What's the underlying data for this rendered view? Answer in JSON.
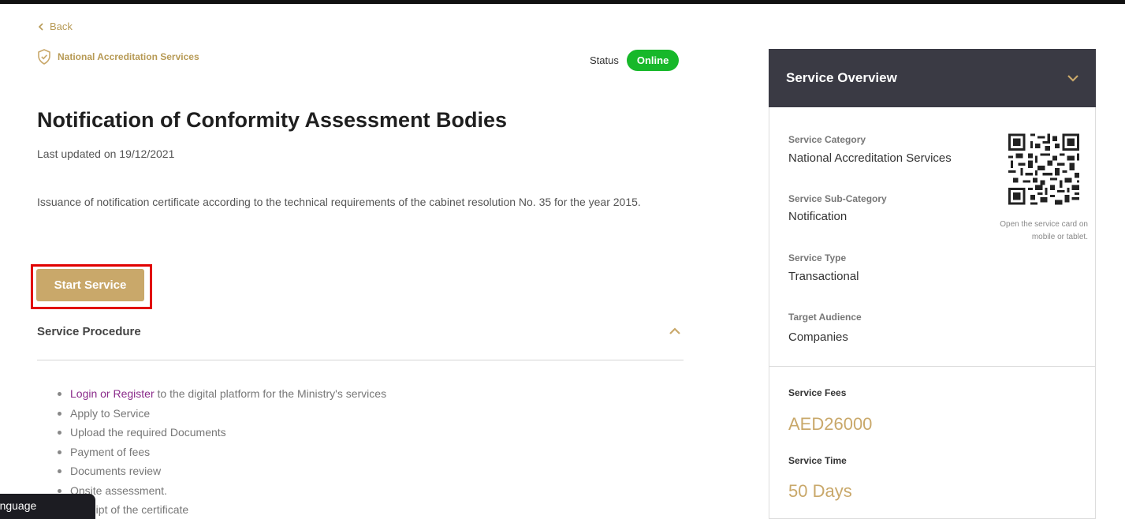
{
  "nav": {
    "back_label": "Back"
  },
  "service": {
    "category": "National Accreditation Services",
    "status_label": "Status",
    "status_value": "Online",
    "title": "Notification of Conformity Assessment Bodies",
    "last_updated": "Last updated on 19/12/2021",
    "description": "Issuance of notification certificate according to the technical requirements of the cabinet resolution No. 35 for the year 2015.",
    "start_button_label": "Start Service"
  },
  "procedure": {
    "title": "Service Procedure",
    "step1_link": "Login or Register",
    "step1_rest": " to the digital platform for the Ministry's services",
    "steps": [
      "Apply to Service",
      "Upload the required Documents",
      "Payment of fees",
      "Documents review",
      "Onsite assessment.",
      "Receipt of the certificate"
    ]
  },
  "language_tab": "Language",
  "overview": {
    "title": "Service Overview",
    "items": [
      {
        "label": "Service Category",
        "value": "National Accreditation Services"
      },
      {
        "label": "Service Sub-Category",
        "value": "Notification"
      },
      {
        "label": "Service Type",
        "value": "Transactional"
      },
      {
        "label": "Target Audience",
        "value": "Companies"
      }
    ],
    "qr_caption": "Open the service card on mobile or tablet.",
    "fees_label": "Service Fees",
    "fees_value": "AED26000",
    "time_label": "Service Time",
    "time_value": "50 Days"
  },
  "colors": {
    "accent_gold": "#c9a86a",
    "status_green": "#17b82a",
    "panel_header": "#3a3a44",
    "highlight_red": "#e10000",
    "link_purple": "#8a2a8a"
  },
  "icons": [
    "chevron-left-icon",
    "shield-check-icon",
    "chevron-up-icon",
    "chevron-down-icon",
    "qr-code-icon"
  ]
}
